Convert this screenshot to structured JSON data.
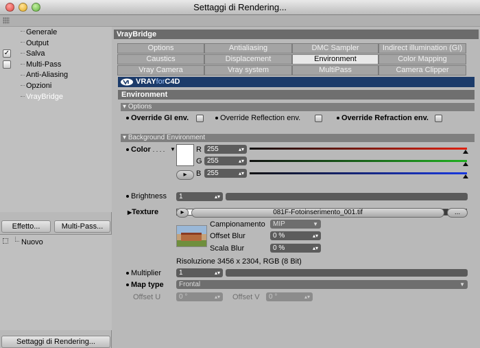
{
  "window": {
    "title": "Settaggi di Rendering..."
  },
  "sidebar": {
    "items": [
      {
        "label": "Generale"
      },
      {
        "label": "Output"
      },
      {
        "label": "Salva"
      },
      {
        "label": "Multi-Pass"
      },
      {
        "label": "Anti-Aliasing"
      },
      {
        "label": "Opzioni"
      },
      {
        "label": "VrayBridge"
      }
    ],
    "effetto_button": "Effetto...",
    "multipass_button": "Multi-Pass...",
    "preset_item": "Nuovo",
    "render_settings_button": "Settaggi di Rendering..."
  },
  "header": {
    "title": "VrayBridge"
  },
  "tabs": [
    [
      "Options",
      "Antialiasing",
      "DMC Sampler",
      "Indirect illumination (GI)"
    ],
    [
      "Caustics",
      "Displacement",
      "Environment",
      "Color Mapping"
    ],
    [
      "Vray Camera",
      "Vray system",
      "MultiPass",
      "Camera Clipper"
    ]
  ],
  "active_tab": "Environment",
  "banner": {
    "logo_vray": "VRAY",
    "logo_for": "for",
    "logo_c4d": "C4D"
  },
  "environment": {
    "section_title": "Environment",
    "options_title": "Options",
    "override_gi": "Override GI env.",
    "override_reflection": "Override Reflection env.",
    "override_refraction": "Override Refraction env.",
    "background_title": "Background Environment",
    "color_label": "Color",
    "color_dots": ". . . .",
    "r_label": "R",
    "g_label": "G",
    "b_label": "B",
    "r_value": "255",
    "g_value": "255",
    "b_value": "255",
    "spin_icon": "up-down-stepper-icon",
    "brightness_label": "Brightness",
    "brightness_value": "1",
    "texture_label": "Texture",
    "texture_file": "081F-Fotoinserimento_001.tif",
    "texture_browse": "...",
    "campionamento_label": "Campionamento",
    "campionamento_value": "MIP",
    "offset_blur_label": "Offset Blur",
    "offset_blur_value": "0 %",
    "scala_blur_label": "Scala Blur",
    "scala_blur_value": "0 %",
    "resolution": "Risoluzione 3456 x 2304, RGB (8 Bit)",
    "multiplier_label": "Multiplier",
    "multiplier_value": "1",
    "map_type_label": "Map type",
    "map_type_value": "Frontal",
    "offset_u_label": "Offset U",
    "offset_u_value": "0 °",
    "offset_v_label": "Offset V",
    "offset_v_value": "0 °"
  },
  "colors": {
    "header_bg": "#6b6b6b",
    "banner_bg": "#1c3b6a",
    "r_slider": "#e02010",
    "g_slider": "#20b020",
    "b_slider": "#1838e0",
    "swatches": [
      "#ffffff",
      "#d9bfb8",
      "#ffffff",
      "#d0ccc4",
      "#1c3bff",
      "#c8c8c8",
      "#cfc3ad",
      "#9e1414",
      "#f02010",
      "#ffffff",
      "#505050",
      "#1d3a32",
      "#9a40f0",
      "#fffbe0",
      "#3c3c3c",
      "#000000"
    ]
  }
}
